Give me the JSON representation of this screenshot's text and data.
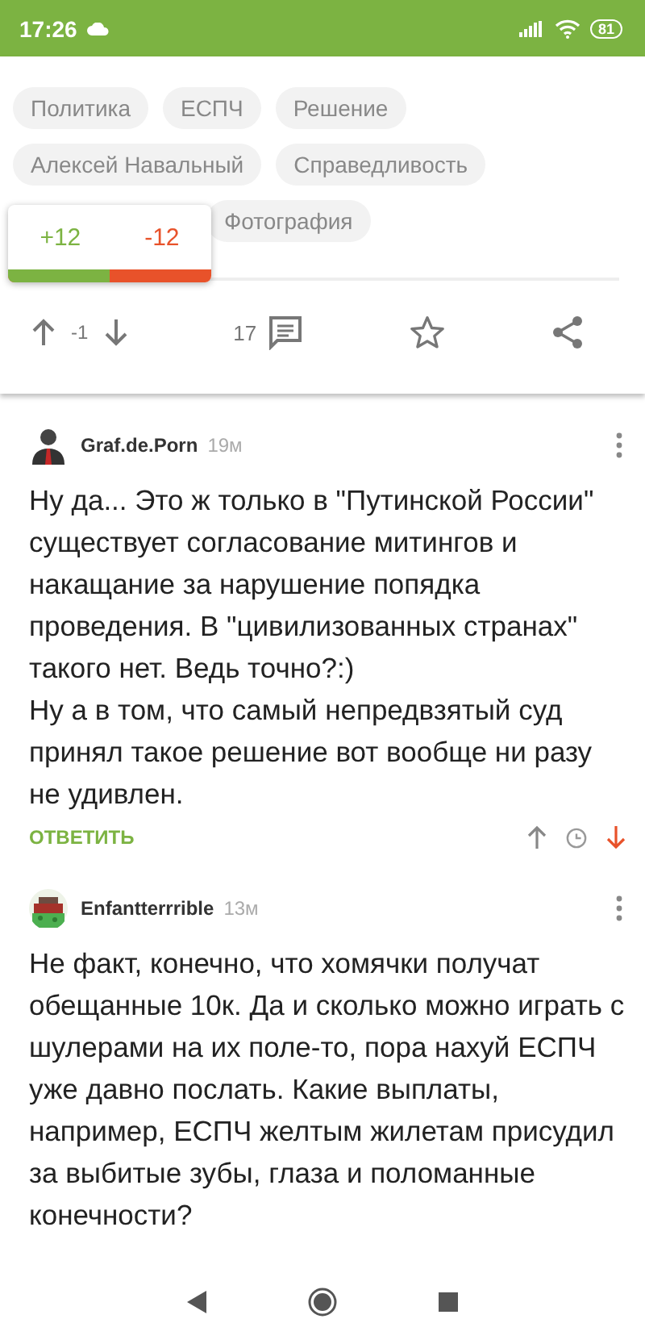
{
  "status_bar": {
    "time": "17:26",
    "battery": "81"
  },
  "post": {
    "tag_rows": [
      [
        "Политика",
        "ЕСПЧ",
        "Решение"
      ],
      [
        "Алексей Навальный",
        "Справедливость"
      ],
      [
        "Фотография"
      ]
    ],
    "vote_popup": {
      "plus": "+12",
      "minus": "-12",
      "level": 0.5
    },
    "rating": "-1",
    "comments_count": "17"
  },
  "comments": [
    {
      "author": "Graf.de.Porn",
      "time": "19м",
      "avatar": {
        "kind": "person"
      },
      "text": "Ну да... Это ж только в \"Путинской России\" существует согласование митингов и накащание за нарушение попядка проведения. В \"цивилизованных странах\" такого нет. Ведь точно?:)\nНу а в том, что самый непредвзятый суд принял такое решение вот вообще ни разу не удивлен.",
      "reply": "ОТВЕТИТЬ",
      "upvoted": false,
      "downvoted": true
    },
    {
      "author": "Enfantterrrible",
      "time": "13м",
      "text": "Не факт, конечно, что хомячки получат обещанные 10к. Да и сколько можно играть с шулерами на их поле-то, пора нахуй ЕСПЧ уже давно послать. Какие выплаты, например, ЕСПЧ желтым жилетам присудил за выбитые зубы, глаза и поломанные конечности?"
    }
  ]
}
